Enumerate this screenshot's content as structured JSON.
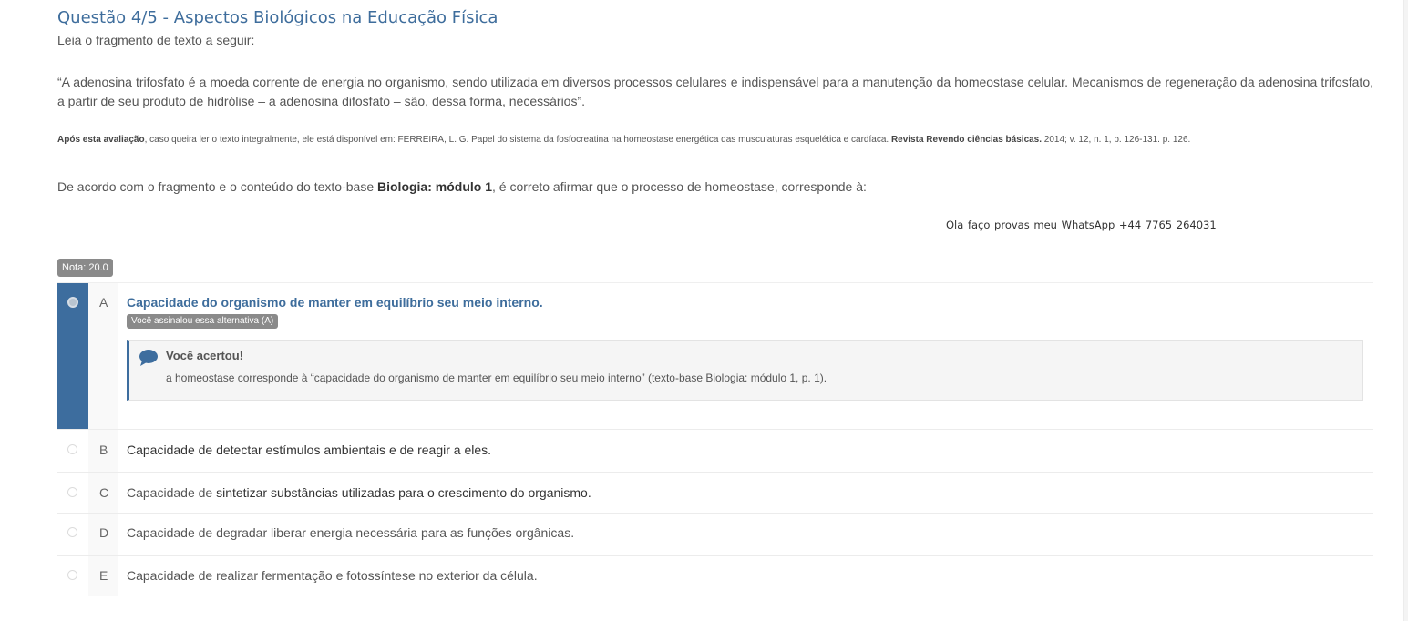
{
  "question": {
    "title": "Questão 4/5 - Aspectos Biológicos na Educação Física",
    "intro": "Leia o fragmento de texto a seguir:",
    "quote": "“A adenosina trifosfato é a moeda corrente de energia no organismo, sendo utilizada em diversos processos celulares e indispensável para a manutenção da homeostase celular. Mecanismos de regeneração da adenosina trifosfato, a partir de seu produto de hidrólise – a adenosina difosfato – são, dessa forma, necessários”.",
    "citation": {
      "bold_lead": "Após esta avaliação",
      "text": ", caso queira ler o texto integralmente, ele está disponível em: FERREIRA, L. G. Papel do sistema da fosfocreatina na homeostase energética das musculaturas esquelética e cardíaca. ",
      "bold_source": "Revista Revendo ciências básicas.",
      "tail": " 2014; v. 12, n. 1, p. 126-131. p. 126."
    },
    "prompt_before": "De acordo com o fragmento e o conteúdo do texto-base ",
    "prompt_bold": "Biologia: módulo 1",
    "prompt_after": ", é correto afirmar que o processo de homeostase, corresponde à:",
    "promo": "Ola faço provas meu  WhatsApp +44 7765 264031",
    "grade_badge": "Nota: 20.0"
  },
  "alternatives": [
    {
      "letter": "A",
      "text": "Capacidade do organismo de manter em equilíbrio seu meio interno.",
      "selected": true
    },
    {
      "letter": "B",
      "text": "Capacidade de detectar estímulos ambientais e de reagir a eles.",
      "selected": false
    },
    {
      "letter": "C",
      "text_a": "Capacidade de ",
      "text_b": "sintetizar substâncias utilizadas para o crescimento do organismo.",
      "selected": false
    },
    {
      "letter": "D",
      "text": "Capacidade de degradar liberar energia necessária para as funções orgânicas.",
      "selected": false
    },
    {
      "letter": "E",
      "text": "Capacidade de realizar fermentação e fotossíntese no exterior da célula.",
      "selected": false
    }
  ],
  "feedback": {
    "marked_label": "Você assinalou essa alternativa (A)",
    "title": "Você acertou!",
    "text": "a homeostase corresponde à “capacidade do organismo de manter em equilíbrio seu meio interno” (texto-base Biologia: módulo 1, p. 1)."
  },
  "icons": {
    "feedback": "speech-bubble-icon"
  },
  "colors": {
    "accent": "#3d6d9e",
    "title": "#3e6d9c",
    "badge": "#8a8a8a"
  }
}
